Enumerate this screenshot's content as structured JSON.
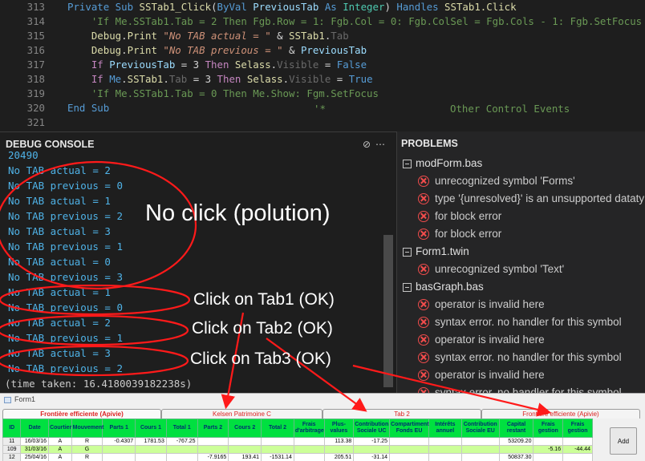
{
  "editor": {
    "lines": [
      {
        "num": "313",
        "parts": [
          [
            "kw",
            "Private Sub "
          ],
          [
            "fn",
            "SSTab1_Click"
          ],
          [
            "pl",
            "("
          ],
          [
            "kw",
            "ByVal "
          ],
          [
            "pr",
            "PreviousTab "
          ],
          [
            "kw",
            "As "
          ],
          [
            "ty",
            "Integer"
          ],
          [
            "pl",
            ") "
          ],
          [
            "kw",
            "Handles "
          ],
          [
            "fn",
            "SSTab1.Click"
          ]
        ]
      },
      {
        "num": "314",
        "parts": [
          [
            "cm",
            "    'If Me.SSTab1.Tab = 2 Then Fgb.Row = 1: Fgb.Col = 0: Fgb.ColSel = Fgb.Cols - 1: Fgb.SetFocus"
          ]
        ]
      },
      {
        "num": "315",
        "parts": [
          [
            "fn",
            "    Debug"
          ],
          [
            "pl",
            "."
          ],
          [
            "fn",
            "Print "
          ],
          [
            "st",
            "\"No TAB actual = \""
          ],
          [
            "pl",
            " & "
          ],
          [
            "fn",
            "SSTab1"
          ],
          [
            "pl",
            "."
          ],
          [
            "hidden",
            "Tab"
          ]
        ]
      },
      {
        "num": "316",
        "parts": [
          [
            "fn",
            "    Debug"
          ],
          [
            "pl",
            "."
          ],
          [
            "fn",
            "Print "
          ],
          [
            "st",
            "\"No TAB previous = \""
          ],
          [
            "pl",
            " & "
          ],
          [
            "pr",
            "PreviousTab"
          ]
        ]
      },
      {
        "num": "317",
        "parts": [
          [
            "ctl",
            "    If "
          ],
          [
            "pr",
            "PreviousTab"
          ],
          [
            "pl",
            " = 3 "
          ],
          [
            "ctl",
            "Then "
          ],
          [
            "fn",
            "Selass"
          ],
          [
            "pl",
            "."
          ],
          [
            "hidden",
            "Visible"
          ],
          [
            "pl",
            " = "
          ],
          [
            "kw",
            "False"
          ]
        ]
      },
      {
        "num": "318",
        "parts": [
          [
            "ctl",
            "    If "
          ],
          [
            "kw",
            "Me"
          ],
          [
            "pl",
            "."
          ],
          [
            "fn",
            "SSTab1"
          ],
          [
            "pl",
            "."
          ],
          [
            "hidden",
            "Tab"
          ],
          [
            "pl",
            " = 3 "
          ],
          [
            "ctl",
            "Then "
          ],
          [
            "fn",
            "Selass"
          ],
          [
            "pl",
            "."
          ],
          [
            "hidden",
            "Visible"
          ],
          [
            "pl",
            " = "
          ],
          [
            "kw",
            "True"
          ]
        ]
      },
      {
        "num": "319",
        "parts": [
          [
            "cm",
            "    'If Me.SSTab1.Tab = 0 Then Me.Show: Fgm.SetFocus"
          ]
        ]
      },
      {
        "num": "320",
        "parts": [
          [
            "kw",
            "End Sub"
          ]
        ]
      },
      {
        "num": "321",
        "parts": []
      }
    ],
    "comment_star": "'*",
    "comment_tail": "Other Control Events"
  },
  "debug": {
    "title": "DEBUG CONSOLE",
    "partial_line": "20490",
    "lines": [
      "No TAB actual = 2",
      "No TAB previous = 0",
      "No TAB actual = 1",
      "No TAB previous = 2",
      "No TAB actual = 3",
      "No TAB previous = 1",
      "No TAB actual = 0",
      "No TAB previous = 3",
      "No TAB actual = 1",
      "No TAB previous = 0",
      "No TAB actual = 2",
      "No TAB previous = 1",
      "No TAB actual = 3",
      "No TAB previous = 2"
    ],
    "time_taken": "(time taken: 16.4180039182238s)"
  },
  "problems": {
    "title": "PROBLEMS",
    "files": [
      {
        "name": "modForm.bas",
        "errors": [
          "unrecognized symbol 'Forms'",
          "type '{unresolved}' is an unsupported datatype",
          "for block error",
          "for block error"
        ]
      },
      {
        "name": "Form1.twin",
        "errors": [
          "unrecognized symbol 'Text'"
        ]
      },
      {
        "name": "basGraph.bas",
        "errors": [
          "operator is invalid here",
          "syntax error. no handler for this symbol",
          "operator is invalid here",
          "syntax error. no handler for this symbol",
          "operator is invalid here",
          "syntax error. no handler for this symbol"
        ]
      }
    ]
  },
  "annotations": {
    "no_click": "No click (polution)",
    "tab1": "Click on Tab1 (OK)",
    "tab2": "Click on Tab2 (OK)",
    "tab3": "Click on Tab3 (OK)",
    "color": "#ff1a1a"
  },
  "form": {
    "title": "Form1",
    "tabs": [
      "Frontière efficiente (Apivie)",
      "Kelsen Patrimoine C",
      "Tab 2",
      "Frontière efficiente (Apivie)"
    ],
    "columns": [
      "ID",
      "Date",
      "Courtier",
      "Mouvement",
      "Parts 1",
      "Cours 1",
      "Total 1",
      "Parts 2",
      "Cours 2",
      "Total 2",
      "Frais d'arbitrage",
      "Plus-values",
      "Contribution Sociale UC",
      "Compartiment Fonds EU",
      "Intérêts annuel",
      "Contribution Sociale EU",
      "Capital restant",
      "Frais gestion",
      "Frais gestion"
    ],
    "rows": [
      [
        "11",
        "16/03/16",
        "A",
        "R",
        "-0.4307",
        "1781.53",
        "-767.25",
        "",
        "",
        "",
        "",
        "113.38",
        "-17.25",
        "",
        "",
        "",
        "53209.20",
        "",
        ""
      ],
      [
        "109",
        "31/03/16",
        "A",
        "G",
        "",
        "",
        "",
        "",
        "",
        "",
        "",
        "",
        "",
        "",
        "",
        "",
        "",
        "-5.16",
        "-44.44"
      ],
      [
        "12",
        "25/04/16",
        "A",
        "R",
        "",
        "",
        "",
        "-7.9165",
        "193.41",
        "-1531.14",
        "",
        "205.51",
        "-31.14",
        "",
        "",
        "",
        "50837.30",
        "",
        ""
      ]
    ],
    "add_label": "Add",
    "header_color": "#00e040",
    "row_highlight": "#ccff99"
  }
}
